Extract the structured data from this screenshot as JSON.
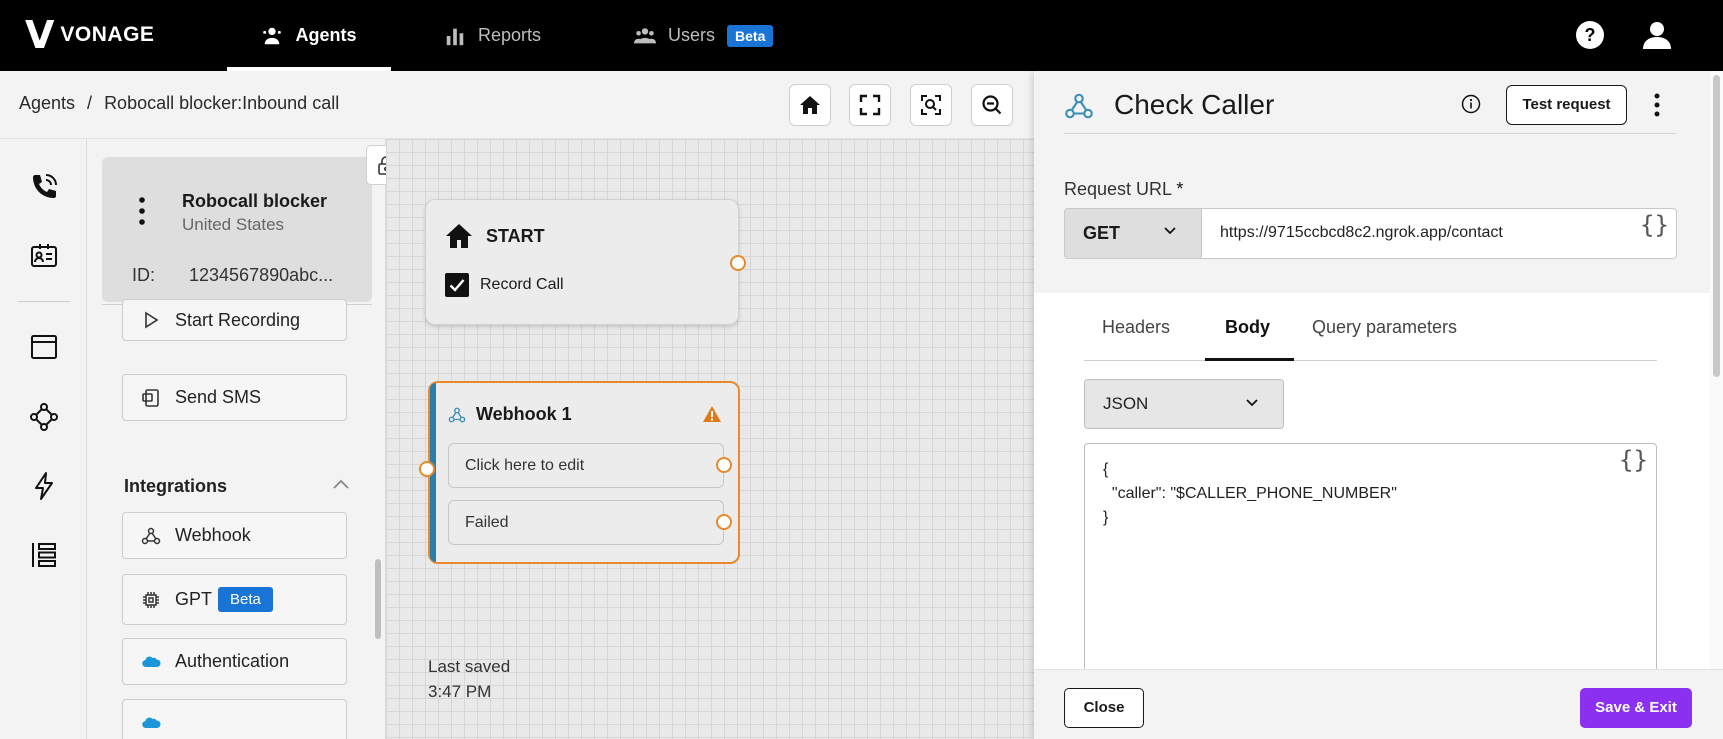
{
  "brand": {
    "name": "VONAGE"
  },
  "nav": {
    "items": [
      {
        "label": "Agents",
        "icon": "agents-icon",
        "active": true
      },
      {
        "label": "Reports",
        "icon": "reports-icon",
        "active": false
      },
      {
        "label": "Users",
        "icon": "users-icon",
        "active": false,
        "badge": "Beta"
      }
    ]
  },
  "breadcrumb": {
    "root": "Agents",
    "separator": "/",
    "current": "Robocall blocker:Inbound call"
  },
  "agent": {
    "name": "Robocall blocker",
    "country": "United States",
    "id_label": "ID:",
    "id_value": "1234567890abc..."
  },
  "components": {
    "start_recording": "Start Recording",
    "send_sms": "Send SMS",
    "integrations_title": "Integrations",
    "webhook": "Webhook",
    "gpt": "GPT",
    "gpt_badge": "Beta",
    "authentication": "Authentication"
  },
  "canvas": {
    "start_node": {
      "title": "START",
      "record_call": "Record Call",
      "record_checked": true
    },
    "webhook_node": {
      "title": "Webhook 1",
      "row_edit": "Click here to edit",
      "row_failed": "Failed"
    },
    "last_saved_label": "Last saved",
    "last_saved_time": "3:47 PM"
  },
  "drawer": {
    "title": "Check Caller",
    "test_request": "Test request",
    "request_url_label": "Request URL",
    "required_mark": "*",
    "method": "GET",
    "url": "https://9715ccbcd8c2.ngrok.app/contact",
    "tabs": [
      "Headers",
      "Body",
      "Query parameters"
    ],
    "active_tab": "Body",
    "body_format": "JSON",
    "body_content": "{\n  \"caller\": \"$CALLER_PHONE_NUMBER\"\n}",
    "close": "Close",
    "save_exit": "Save & Exit"
  },
  "colors": {
    "accent_orange": "#e8892b",
    "primary_purple": "#8b2ff0",
    "beta_blue": "#1a74d6",
    "topbar": "#000000"
  }
}
